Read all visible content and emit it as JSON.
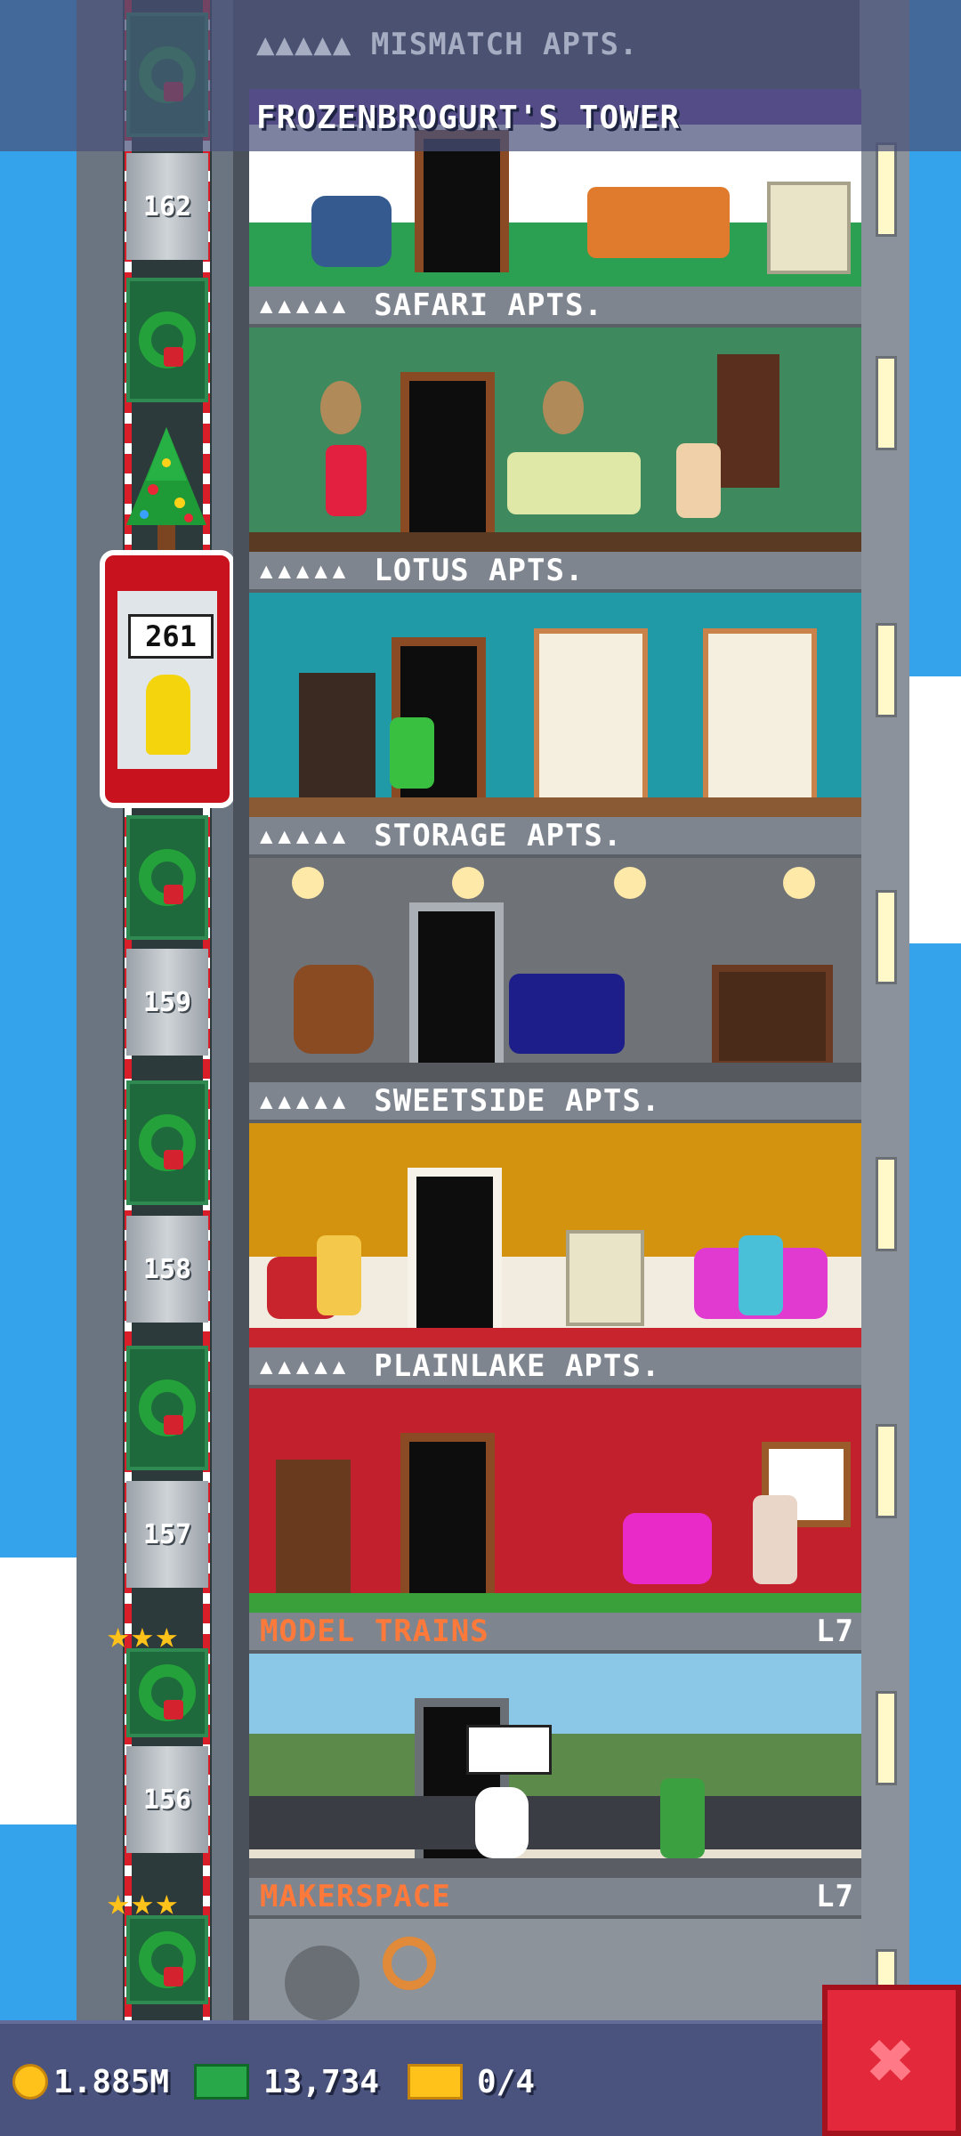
{
  "header": {
    "ghost_floor_label": "MISMATCH APTS.",
    "tower_title": "FROZENBROGURT'S TOWER"
  },
  "elevator": {
    "current_floor": "261",
    "floor_numbers": [
      "162",
      "159",
      "158",
      "157",
      "156"
    ]
  },
  "floors": [
    {
      "label": "SAFARI APTS.",
      "residents_icons": "▲▲▲▲▲",
      "level": "",
      "color": "#3e8a5e"
    },
    {
      "label": "LOTUS APTS.",
      "residents_icons": "▲▲▲▲▲",
      "level": "",
      "color": "#1f9aa6"
    },
    {
      "label": "STORAGE APTS.",
      "residents_icons": "▲▲▲▲▲",
      "level": "",
      "color": "#6f7378"
    },
    {
      "label": "SWEETSIDE APTS.",
      "residents_icons": "▲▲▲▲▲",
      "level": "",
      "color": "#d3930f"
    },
    {
      "label": "PLAINLAKE APTS.",
      "residents_icons": "▲▲▲▲▲",
      "level": "",
      "color": "#c3202e"
    },
    {
      "label": "MODEL TRAINS",
      "residents_icons": "",
      "level": "L7",
      "color": "#8bc8e8"
    },
    {
      "label": "MAKERSPACE",
      "residents_icons": "",
      "level": "L7",
      "color": "#8c939b"
    }
  ],
  "footer": {
    "coins": "1.885M",
    "bux": "13,734",
    "tickets": "0/4",
    "close_icon": "✖"
  },
  "colors": {
    "sky": "#35a3ec",
    "bottom_bar": "#4a537e",
    "close_button": "#e2283a",
    "business_label": "#ff7a3a"
  }
}
